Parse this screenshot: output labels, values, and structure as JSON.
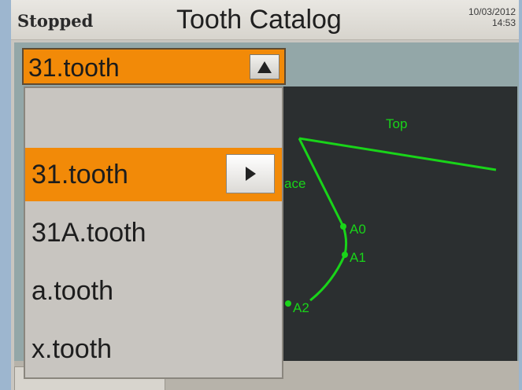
{
  "header": {
    "status": "Stopped",
    "title": "Tooth Catalog",
    "date": "10/03/2012",
    "time": "14:53"
  },
  "dropdown": {
    "selected_value": "31.tooth",
    "options": [
      "31.tooth",
      "31A.tooth",
      "a.tooth",
      "x.tooth"
    ]
  },
  "diagram": {
    "labels": {
      "top": "Top",
      "face": "ace",
      "a0": "A0",
      "a1": "A1",
      "a2": "A2"
    },
    "line_color": "#19d419"
  },
  "colors": {
    "accent_orange": "#f28a08",
    "canvas_bg": "#2b2f30"
  }
}
